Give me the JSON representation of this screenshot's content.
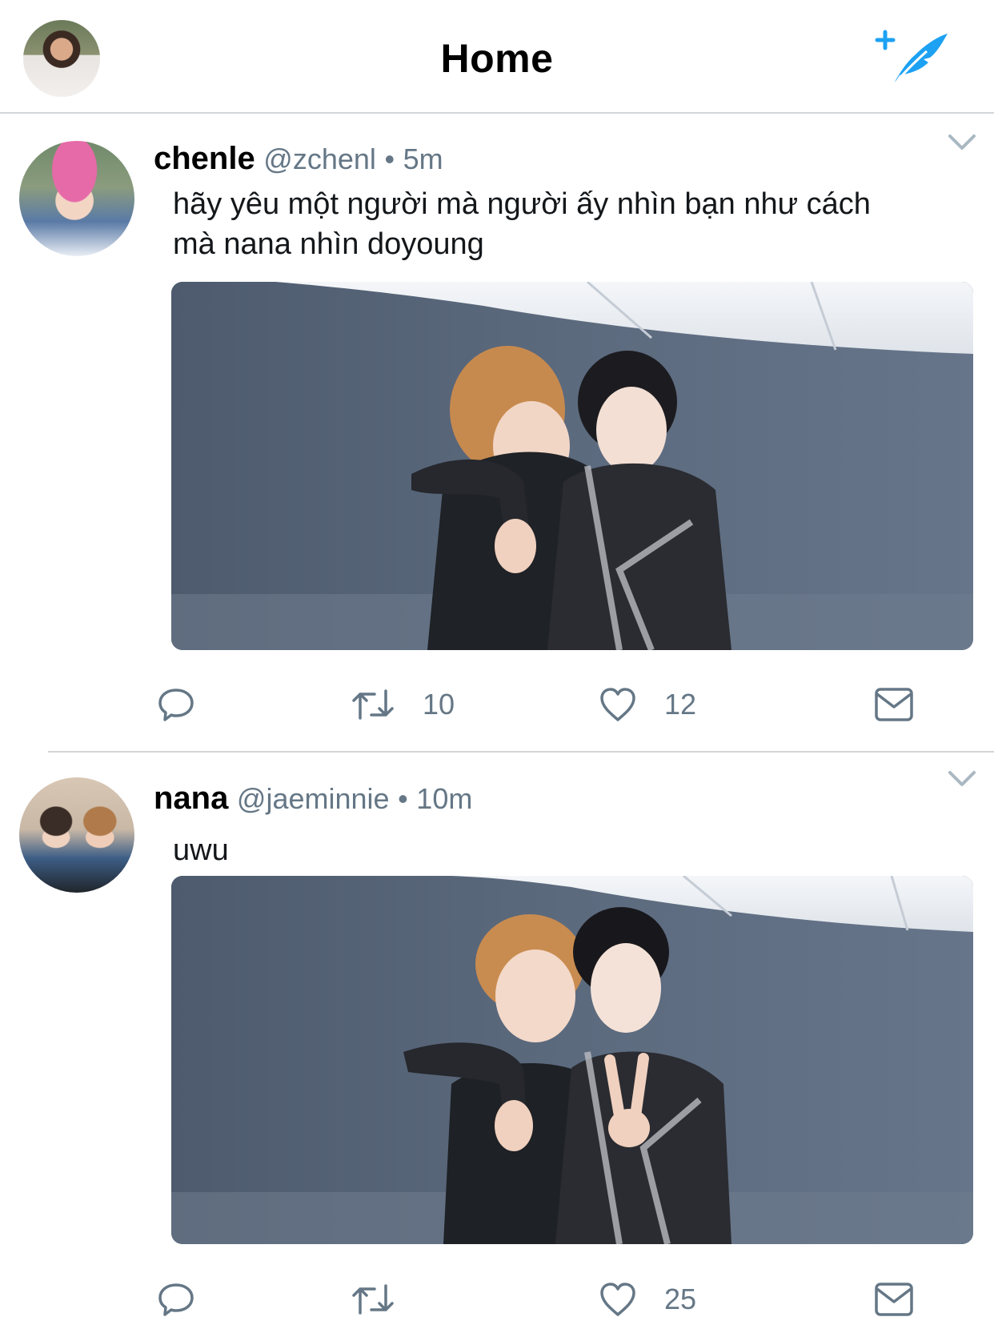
{
  "header": {
    "title": "Home",
    "avatar_icon": "profile-avatar",
    "compose_icon": "compose-tweet-icon"
  },
  "colors": {
    "twitter_blue": "#1da1f2",
    "muted_text": "#657786",
    "divider": "#d3d6d9",
    "icon_gray": "#657786"
  },
  "tweets": [
    {
      "display_name": "chenle",
      "handle": "@zchenl",
      "dot": "•",
      "time": "5m",
      "text": "hãy yêu một người mà người ấy nhìn bạn như cách mà nana nhìn doyoung",
      "actions": {
        "reply_count": "",
        "retweet_count": "10",
        "like_count": "12"
      }
    },
    {
      "display_name": "nana",
      "handle": "@jaeminnie",
      "dot": "•",
      "time": "10m",
      "text": "uwu",
      "actions": {
        "reply_count": "",
        "retweet_count": "",
        "like_count": "25"
      }
    }
  ]
}
